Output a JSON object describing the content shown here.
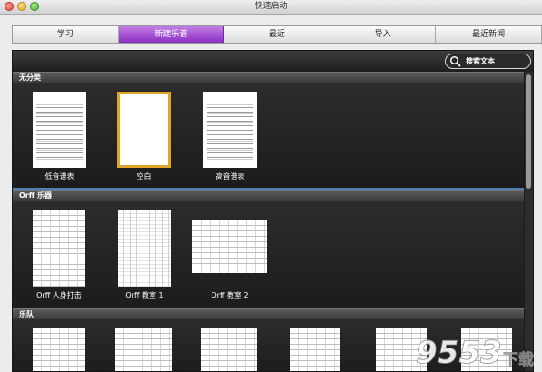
{
  "window": {
    "title": "快速启动"
  },
  "tabs": [
    {
      "label": "学习",
      "active": false
    },
    {
      "label": "新建乐谱",
      "active": true
    },
    {
      "label": "最近",
      "active": false
    },
    {
      "label": "导入",
      "active": false
    },
    {
      "label": "最近新闻",
      "active": false
    }
  ],
  "search": {
    "placeholder": "搜索文本"
  },
  "sections": [
    {
      "title": "无分类",
      "items": [
        {
          "label": "低音谱表"
        },
        {
          "label": "空白",
          "selected": true
        },
        {
          "label": "高音谱表"
        }
      ]
    },
    {
      "title": "Orff 乐器",
      "items": [
        {
          "label": "Orff 人身打击"
        },
        {
          "label": "Orff 教室 1"
        },
        {
          "label": "Orff 教室 2"
        }
      ]
    },
    {
      "title": "乐队",
      "items": []
    }
  ],
  "watermark": {
    "text": "9553",
    "subtext": "下载"
  },
  "colors": {
    "accent_tab": "#9b45d1",
    "selection": "#e0a628",
    "panel": "#262626"
  }
}
